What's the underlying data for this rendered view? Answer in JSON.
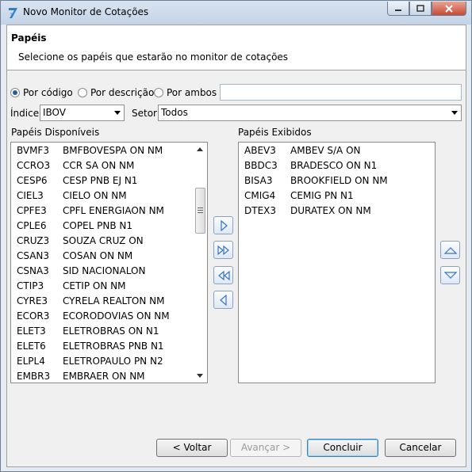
{
  "window": {
    "title": "Novo Monitor de Cotações",
    "controls": [
      "minimize-icon",
      "maximize-icon",
      "close-icon"
    ]
  },
  "header": {
    "title": "Papéis",
    "subtitle": "Selecione os papéis que estarão no monitor de cotações"
  },
  "search": {
    "options": [
      {
        "label": "Por código",
        "selected": true
      },
      {
        "label": "Por descrição",
        "selected": false
      },
      {
        "label": "Por ambos",
        "selected": false
      }
    ],
    "value": ""
  },
  "filters": {
    "indice_label": "Índice",
    "indice_value": "IBOV",
    "setor_label": "Setor",
    "setor_value": "Todos"
  },
  "available": {
    "label": "Papéis Disponíveis",
    "items": [
      {
        "code": "BVMF3",
        "desc": "BMFBOVESPA ON NM"
      },
      {
        "code": "CCRO3",
        "desc": "CCR SA ON NM"
      },
      {
        "code": "CESP6",
        "desc": "CESP PNB EJ N1"
      },
      {
        "code": "CIEL3",
        "desc": "CIELO ON NM"
      },
      {
        "code": "CPFE3",
        "desc": "CPFL ENERGIAON NM"
      },
      {
        "code": "CPLE6",
        "desc": "COPEL PNB N1"
      },
      {
        "code": "CRUZ3",
        "desc": "SOUZA CRUZ ON"
      },
      {
        "code": "CSAN3",
        "desc": "COSAN ON NM"
      },
      {
        "code": "CSNA3",
        "desc": "SID NACIONALON"
      },
      {
        "code": "CTIP3",
        "desc": "CETIP ON NM"
      },
      {
        "code": "CYRE3",
        "desc": "CYRELA REALTON NM"
      },
      {
        "code": "ECOR3",
        "desc": "ECORODOVIAS ON NM"
      },
      {
        "code": "ELET3",
        "desc": "ELETROBRAS ON N1"
      },
      {
        "code": "ELET6",
        "desc": "ELETROBRAS PNB N1"
      },
      {
        "code": "ELPL4",
        "desc": "ELETROPAULO PN N2"
      },
      {
        "code": "EMBR3",
        "desc": "EMBRAER ON NM"
      }
    ]
  },
  "shown": {
    "label": "Papéis Exibidos",
    "items": [
      {
        "code": "ABEV3",
        "desc": "AMBEV S/A ON"
      },
      {
        "code": "BBDC3",
        "desc": "BRADESCO ON N1"
      },
      {
        "code": "BISA3",
        "desc": "BROOKFIELD ON NM"
      },
      {
        "code": "CMIG4",
        "desc": "CEMIG PN N1"
      },
      {
        "code": "DTEX3",
        "desc": "DURATEX ON NM"
      }
    ]
  },
  "transfer_buttons": [
    "move-right-icon",
    "move-all-right-icon",
    "move-all-left-icon",
    "move-left-icon"
  ],
  "order_buttons": [
    "move-up-icon",
    "move-down-icon"
  ],
  "footer": {
    "back": "< Voltar",
    "next": "Avançar >",
    "finish": "Concluir",
    "cancel": "Cancelar"
  },
  "colors": {
    "accent": "#2c5aa0",
    "arrow": "#3a74c4"
  }
}
